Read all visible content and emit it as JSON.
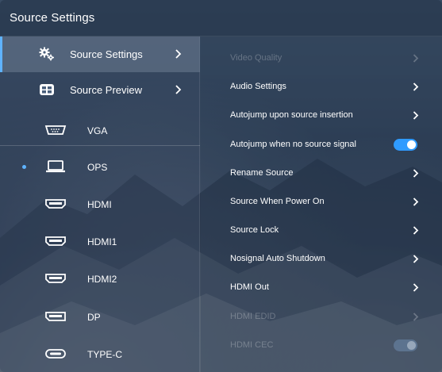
{
  "window": {
    "title": "Source Settings"
  },
  "left_menu": [
    {
      "label": "Source Settings",
      "icon": "gear-icon",
      "active": true,
      "has_arrow": true
    },
    {
      "label": "Source Preview",
      "icon": "preview-icon",
      "active": false,
      "has_arrow": true
    }
  ],
  "sources": [
    {
      "label": "VGA",
      "icon": "vga-icon",
      "current": false
    },
    {
      "label": "OPS",
      "icon": "ops-laptop-icon",
      "current": true
    },
    {
      "label": "HDMI",
      "icon": "hdmi-icon",
      "current": false
    },
    {
      "label": "HDMI1",
      "icon": "hdmi-icon",
      "current": false
    },
    {
      "label": "HDMI2",
      "icon": "hdmi-icon",
      "current": false
    },
    {
      "label": "DP",
      "icon": "displayport-icon",
      "current": false
    },
    {
      "label": "TYPE-C",
      "icon": "type-c-icon",
      "current": false
    }
  ],
  "settings": [
    {
      "label": "Video Quality",
      "control": "arrow",
      "enabled": false
    },
    {
      "label": "Audio Settings",
      "control": "arrow",
      "enabled": true
    },
    {
      "label": "Autojump upon source insertion",
      "control": "arrow",
      "enabled": true
    },
    {
      "label": "Autojump when no source signal",
      "control": "toggle",
      "toggle_on": true,
      "enabled": true
    },
    {
      "label": "Rename Source",
      "control": "arrow",
      "enabled": true
    },
    {
      "label": "Source When Power On",
      "control": "arrow",
      "enabled": true
    },
    {
      "label": "Source Lock",
      "control": "arrow",
      "enabled": true
    },
    {
      "label": "Nosignal Auto Shutdown",
      "control": "arrow",
      "enabled": true
    },
    {
      "label": "HDMI Out",
      "control": "arrow",
      "enabled": true
    },
    {
      "label": "HDMI EDID",
      "control": "arrow",
      "enabled": false
    },
    {
      "label": "HDMI CEC",
      "control": "toggle",
      "toggle_on": true,
      "enabled": false
    }
  ],
  "colors": {
    "accent": "#2f9bff",
    "active_indicator": "#5fb3ff"
  }
}
